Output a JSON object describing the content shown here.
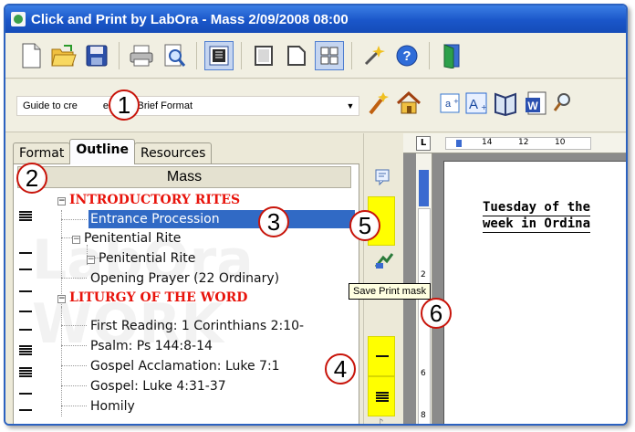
{
  "window": {
    "title": "Click and Print by LabOra - Mass 2/09/2008 08:00"
  },
  "toolbar": {
    "icons": [
      "new-document-icon",
      "open-folder-icon",
      "save-disk-icon",
      "print-icon",
      "print-preview-icon",
      "outline-view-icon",
      "single-page-icon",
      "page-icon",
      "grid-view-icon",
      "wizard-icon",
      "help-icon",
      "exit-door-icon"
    ]
  },
  "format_bar": {
    "guide_text": "Guide to cre",
    "guide_text_rest": "eople's Brief Format",
    "icons": [
      "magic-wand-icon",
      "home-icon",
      "text-small-icon",
      "text-large-icon",
      "book-icon",
      "word-doc-icon",
      "search-icon"
    ]
  },
  "tabs": [
    {
      "label": "Format"
    },
    {
      "label": "Outline"
    },
    {
      "label": "Resources"
    }
  ],
  "outline": {
    "header": "Mass",
    "items": [
      {
        "label": "INTRODUCTORY RITES",
        "kind": "section"
      },
      {
        "label": "Entrance Procession",
        "kind": "item",
        "selected": true
      },
      {
        "label": "Penitential Rite",
        "kind": "group"
      },
      {
        "label": "Penitential Rite",
        "kind": "subgroup"
      },
      {
        "label": "Opening Prayer (22 Ordinary)",
        "kind": "item"
      },
      {
        "label": "LITURGY OF THE WORD",
        "kind": "section"
      },
      {
        "label": "First Reading: 1 Corinthians 2:10-",
        "kind": "item"
      },
      {
        "label": "Psalm: Ps 144:8-14",
        "kind": "item"
      },
      {
        "label": "Gospel Acclamation: Luke 7:1",
        "kind": "item"
      },
      {
        "label": "Gospel: Luke 4:31-37",
        "kind": "item"
      },
      {
        "label": "Homily",
        "kind": "item"
      }
    ]
  },
  "tooltip": "Save Print mask",
  "callouts": [
    "1",
    "2",
    "3",
    "4",
    "5",
    "6"
  ],
  "ruler": {
    "corner": "L",
    "top_ticks": [
      "14",
      "12",
      "10"
    ],
    "left_ticks": [
      "2",
      "6",
      "8"
    ]
  },
  "document": {
    "line1": "Tuesday of the",
    "line2": "week in Ordina"
  },
  "colors": {
    "title_bar": "#1a56c9",
    "section_text": "#e8140c",
    "selection": "#316ac5",
    "highlight": "#ffff00",
    "callout_border": "#c8140a"
  }
}
